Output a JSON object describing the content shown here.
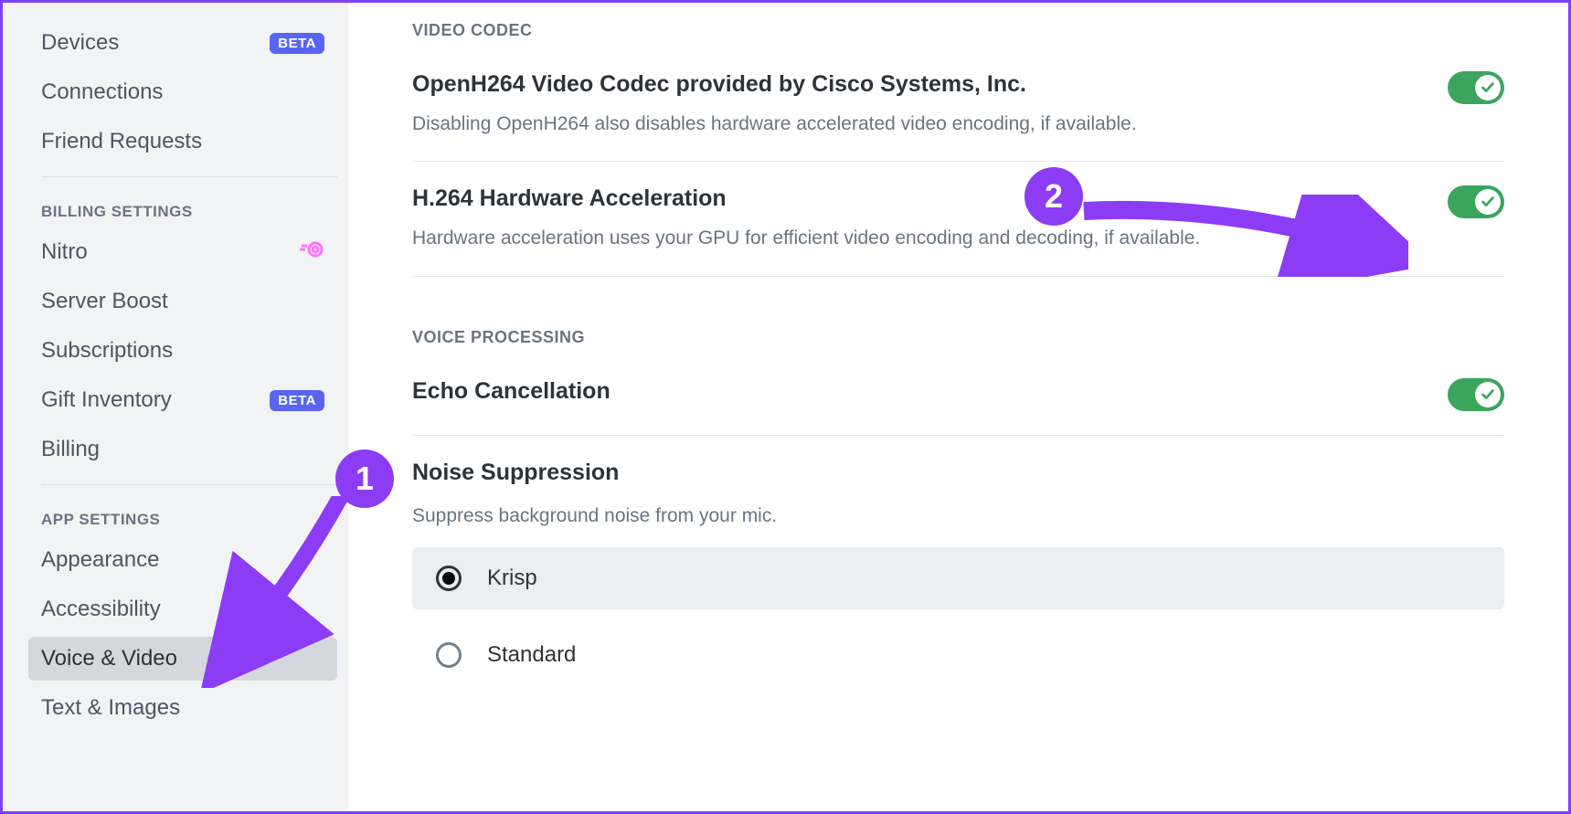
{
  "sidebar": {
    "items_top": [
      {
        "label": "Devices",
        "badge": "BETA"
      },
      {
        "label": "Connections"
      },
      {
        "label": "Friend Requests"
      }
    ],
    "billing_header": "BILLING SETTINGS",
    "items_billing": [
      {
        "label": "Nitro",
        "nitro": true
      },
      {
        "label": "Server Boost"
      },
      {
        "label": "Subscriptions"
      },
      {
        "label": "Gift Inventory",
        "badge": "BETA"
      },
      {
        "label": "Billing"
      }
    ],
    "app_header": "APP SETTINGS",
    "items_app": [
      {
        "label": "Appearance"
      },
      {
        "label": "Accessibility"
      },
      {
        "label": "Voice & Video",
        "active": true
      },
      {
        "label": "Text & Images"
      }
    ]
  },
  "main": {
    "video_codec_header": "VIDEO CODEC",
    "openh264_title": "OpenH264 Video Codec provided by Cisco Systems, Inc.",
    "openh264_desc": "Disabling OpenH264 also disables hardware accelerated video encoding, if available.",
    "h264_title": "H.264 Hardware Acceleration",
    "h264_desc": "Hardware acceleration uses your GPU for efficient video encoding and decoding, if available.",
    "voice_processing_header": "VOICE PROCESSING",
    "echo_title": "Echo Cancellation",
    "noise_title": "Noise Suppression",
    "noise_desc": "Suppress background noise from your mic.",
    "noise_options": {
      "krisp": "Krisp",
      "standard": "Standard"
    }
  },
  "annotations": {
    "badge1": "1",
    "badge2": "2"
  }
}
